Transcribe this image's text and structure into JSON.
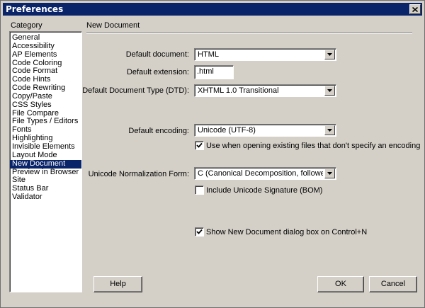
{
  "window": {
    "title": "Preferences"
  },
  "category": {
    "heading": "Category",
    "items": [
      "General",
      "Accessibility",
      "AP Elements",
      "Code Coloring",
      "Code Format",
      "Code Hints",
      "Code Rewriting",
      "Copy/Paste",
      "CSS Styles",
      "File Compare",
      "File Types / Editors",
      "Fonts",
      "Highlighting",
      "Invisible Elements",
      "Layout Mode",
      "New Document",
      "Preview in Browser",
      "Site",
      "Status Bar",
      "Validator"
    ],
    "selected": "New Document"
  },
  "panel": {
    "title": "New Document",
    "default_document_label": "Default document:",
    "default_document_value": "HTML",
    "default_extension_label": "Default extension:",
    "default_extension_value": ".html",
    "default_dtd_label": "Default Document Type (DTD):",
    "default_dtd_value": "XHTML 1.0 Transitional",
    "default_encoding_label": "Default encoding:",
    "default_encoding_value": "Unicode (UTF-8)",
    "use_encoding_label": "Use when opening existing files that don't specify an encoding",
    "use_encoding_checked": true,
    "normalization_label": "Unicode Normalization Form:",
    "normalization_value": "C (Canonical Decomposition, followed by C",
    "include_bom_label": "Include Unicode Signature (BOM)",
    "include_bom_checked": false,
    "show_dialog_label": "Show New Document dialog box on Control+N",
    "show_dialog_checked": true
  },
  "buttons": {
    "help": "Help",
    "ok": "OK",
    "cancel": "Cancel"
  },
  "icons": {
    "close": "close-icon",
    "dropdown": "chevron-down-icon",
    "check": "checkmark-icon"
  },
  "colors": {
    "titlebar": "#0a246a",
    "selection": "#0a246a",
    "dialog_bg": "#d4d0c8"
  }
}
